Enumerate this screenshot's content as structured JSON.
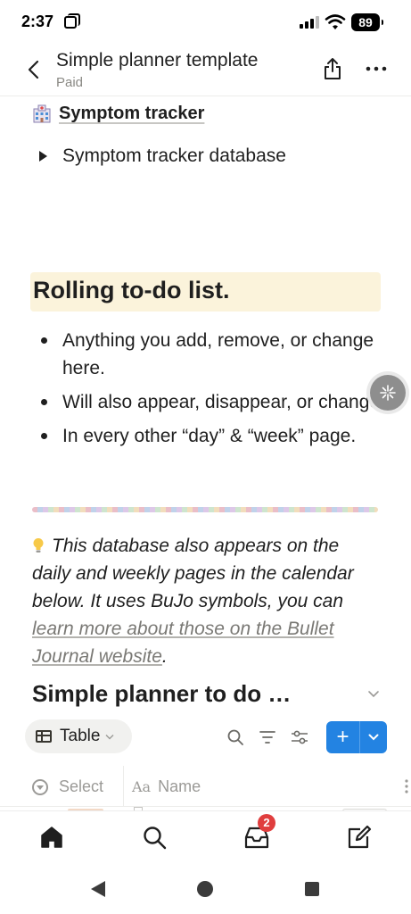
{
  "status_bar": {
    "time": "2:37",
    "battery": "89"
  },
  "header": {
    "title": "Simple planner template",
    "subtitle": "Paid"
  },
  "symptom_link": {
    "label": "Symptom tracker"
  },
  "toggle_block": {
    "label": "Symptom tracker database"
  },
  "heading": {
    "text": "Rolling to-do list."
  },
  "bullets": [
    "Anything you add, remove, or change here.",
    "Will also appear, disappear, or change.",
    "In every other “day” & “week” page."
  ],
  "callout": {
    "text": "This database also appears on the daily and weekly pages in the calendar below. It uses BuJo symbols, you can ",
    "link_text": "learn more about those on the Bullet Journal website",
    "suffix": "."
  },
  "database": {
    "title": "Simple planner to do …",
    "view_label": "Table",
    "columns": {
      "select": "Select",
      "name": "Name"
    }
  },
  "tabbar": {
    "inbox_badge": "2"
  },
  "colors": {
    "accent": "#2383e2",
    "heading_bg": "#fbf3db",
    "badge": "#e03e3e"
  }
}
